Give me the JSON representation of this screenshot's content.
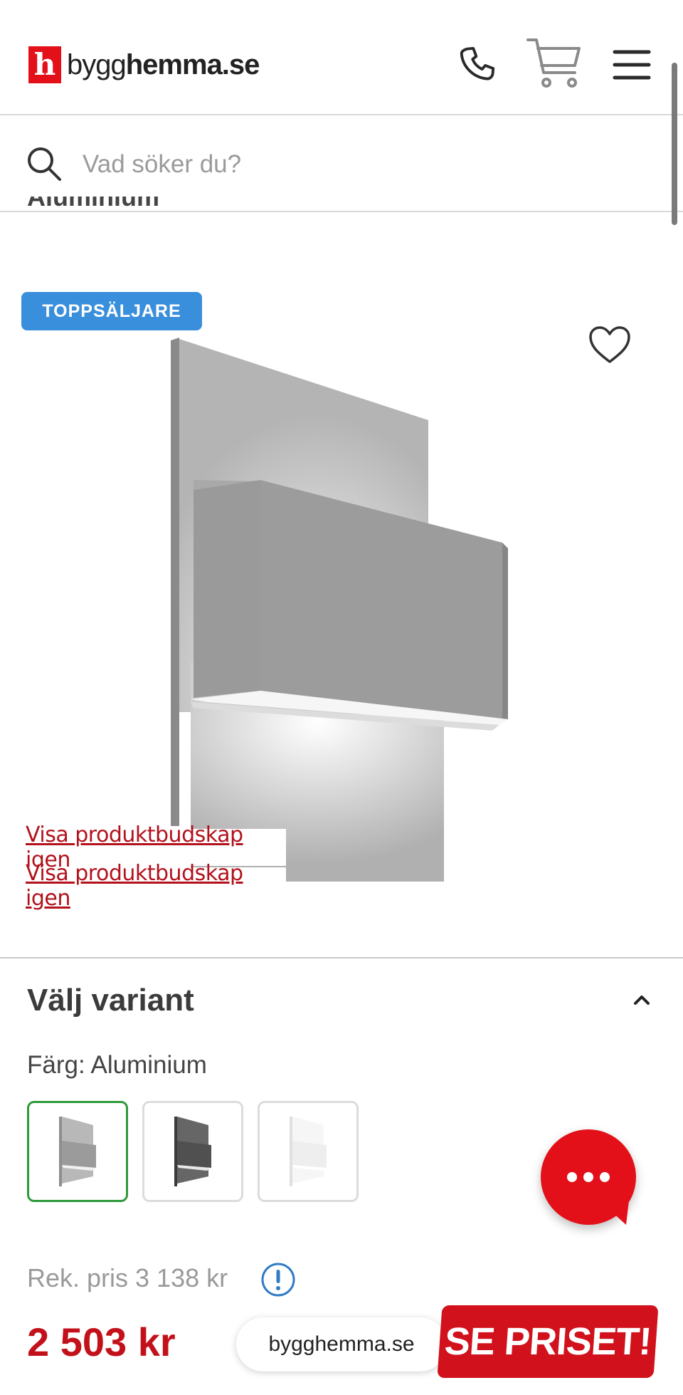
{
  "header": {
    "logo_mark": "h",
    "logo_text_a": "bygg",
    "logo_text_b": "hemma.se"
  },
  "search": {
    "placeholder": "Vad söker du?"
  },
  "product": {
    "title_cut": "Aluminium",
    "badge": "TOPPSÄLJARE",
    "promo_links": [
      "Visa produktbudskap igen",
      "Visa produktbudskap igen"
    ]
  },
  "variant": {
    "title": "Välj variant",
    "color_label": "Färg: Aluminium",
    "swatches": [
      {
        "name": "Aluminium",
        "color": "#9b9b9b",
        "selected": true
      },
      {
        "name": "Grafit",
        "color": "#505050",
        "selected": false
      },
      {
        "name": "Vit",
        "color": "#f0f0f0",
        "selected": false
      }
    ]
  },
  "pricing": {
    "rek": "Rek. pris 3 138 kr",
    "price": "2 503 kr"
  },
  "ad": {
    "site": "bygghemma.se",
    "cta": "SE PRISET!"
  },
  "colors": {
    "brand_red": "#e3101a",
    "price_red": "#c3111b",
    "badge_blue": "#3a8fdc",
    "selected_green": "#2e9a3a"
  },
  "icons": [
    "phone-icon",
    "cart-icon",
    "menu-icon",
    "search-icon",
    "heart-icon",
    "chevron-up-icon",
    "chat-icon",
    "info-icon"
  ]
}
